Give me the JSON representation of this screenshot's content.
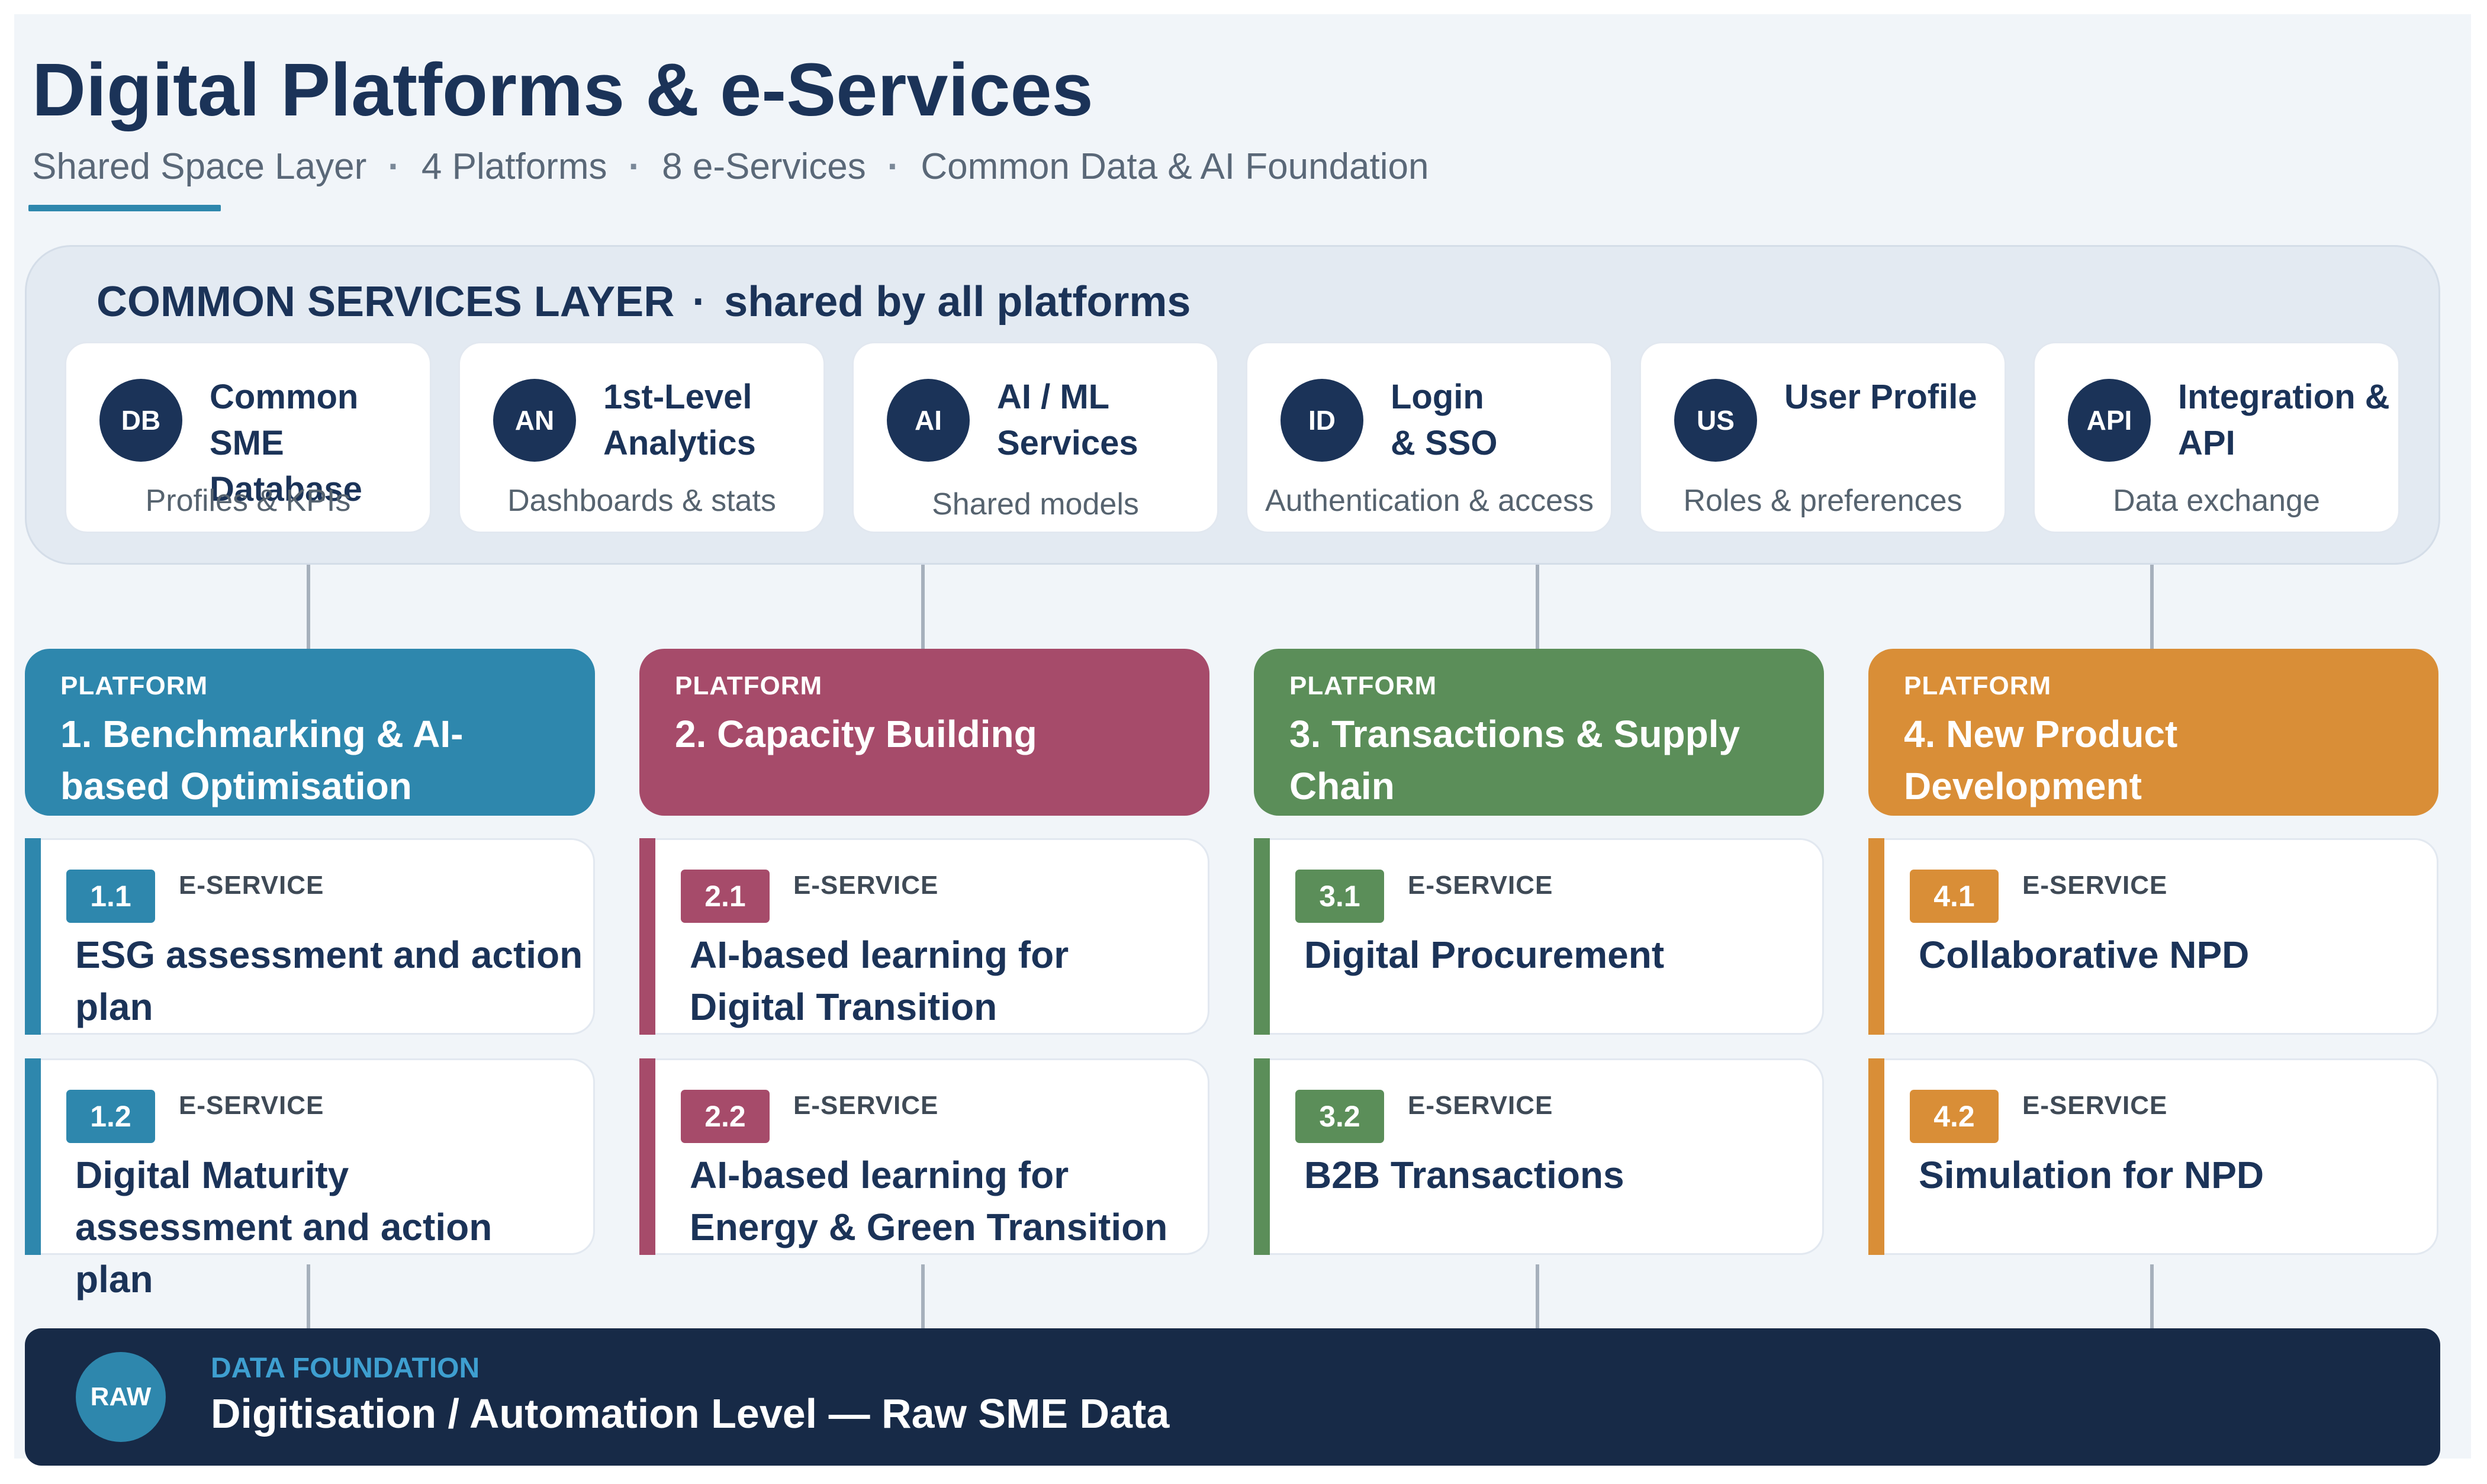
{
  "header": {
    "title": "Digital Platforms & e-Services",
    "subtitle": [
      "Shared Space Layer",
      "4 Platforms",
      "8 e-Services",
      "Common Data & AI Foundation"
    ]
  },
  "common_layer": {
    "title": "COMMON SERVICES LAYER",
    "subtitle": "shared by all platforms",
    "services": [
      {
        "badge": "DB",
        "name": "Common SME Database",
        "desc": "Profiles & KPIs"
      },
      {
        "badge": "AN",
        "name": "1st-Level Analytics",
        "desc": "Dashboards & stats"
      },
      {
        "badge": "AI",
        "name": "AI / ML Services",
        "desc": "Shared models"
      },
      {
        "badge": "ID",
        "name": "Login & SSO",
        "desc": "Authentication & access"
      },
      {
        "badge": "US",
        "name": "User Profile",
        "desc": "Roles & preferences"
      },
      {
        "badge": "API",
        "name": "Integration & API",
        "desc": "Data exchange"
      }
    ]
  },
  "platforms": [
    {
      "label": "PLATFORM",
      "title": "1. Benchmarking & AI-based Optimisation",
      "color": "#2e87ad",
      "eservices": [
        {
          "num": "1.1",
          "label": "E-SERVICE",
          "name": "ESG assessment and action plan"
        },
        {
          "num": "1.2",
          "label": "E-SERVICE",
          "name": "Digital Maturity assessment and action plan"
        }
      ]
    },
    {
      "label": "PLATFORM",
      "title": "2. Capacity Building",
      "color": "#a64b6a",
      "eservices": [
        {
          "num": "2.1",
          "label": "E-SERVICE",
          "name": "AI-based learning for Digital Transition"
        },
        {
          "num": "2.2",
          "label": "E-SERVICE",
          "name": "AI-based learning for Energy & Green Transition"
        }
      ]
    },
    {
      "label": "PLATFORM",
      "title": "3. Transactions & Supply Chain",
      "color": "#5b8e59",
      "eservices": [
        {
          "num": "3.1",
          "label": "E-SERVICE",
          "name": "Digital Procurement"
        },
        {
          "num": "3.2",
          "label": "E-SERVICE",
          "name": "B2B Transactions"
        }
      ]
    },
    {
      "label": "PLATFORM",
      "title": "4. New Product Development",
      "color": "#d98e37",
      "eservices": [
        {
          "num": "4.1",
          "label": "E-SERVICE",
          "name": "Collaborative NPD"
        },
        {
          "num": "4.2",
          "label": "E-SERVICE",
          "name": "Simulation for NPD"
        }
      ]
    }
  ],
  "foundation": {
    "badge": "RAW",
    "label": "DATA FOUNDATION",
    "title": "Digitisation / Automation Level — Raw SME Data"
  }
}
